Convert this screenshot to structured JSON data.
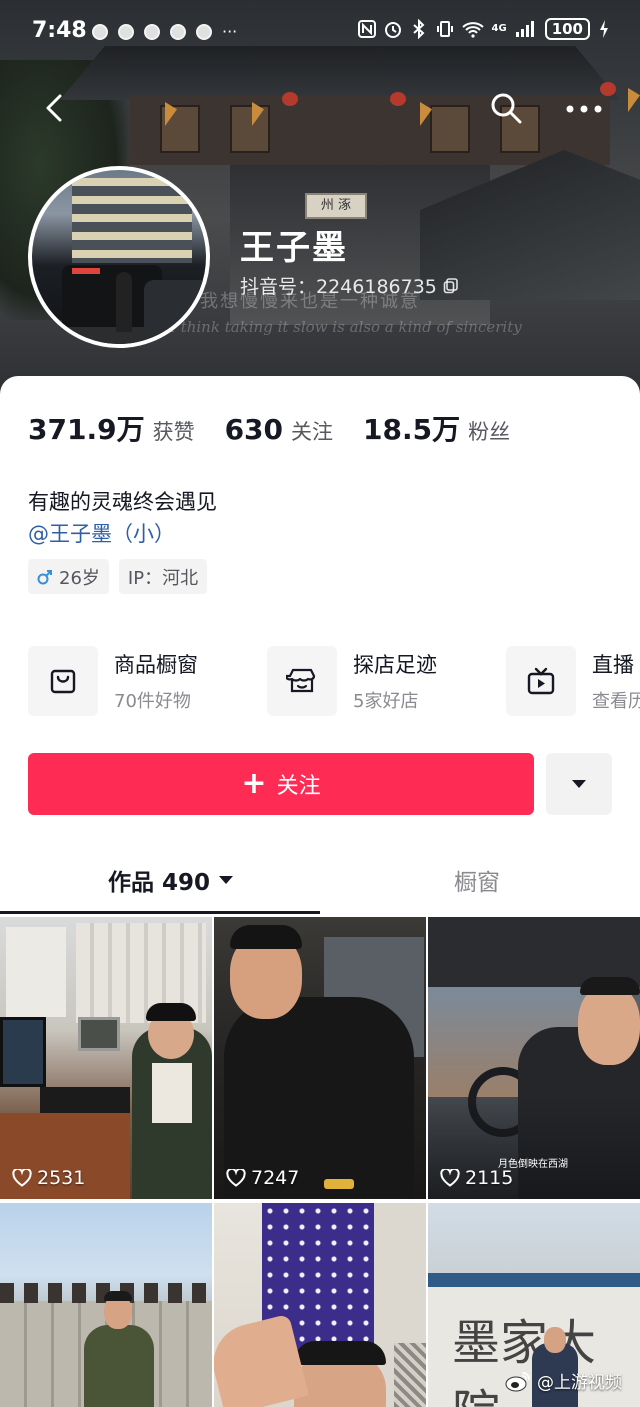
{
  "status_bar": {
    "time": "7:48",
    "more_dots": "···",
    "network": "4G",
    "battery": "100"
  },
  "cover": {
    "plaque_text": "州 涿",
    "signature_cn": "我想慢慢来也是一种诚意",
    "signature_en": "I think taking it slow is also a kind of sincerity"
  },
  "profile": {
    "nickname": "王子墨",
    "douyin_id": "抖音号：2246186735",
    "bio": "有趣的灵魂终会遇见",
    "mention": "@王子墨（小）",
    "tags": [
      {
        "icon": "male-icon",
        "label": "26岁"
      },
      {
        "label": "IP：河北"
      }
    ]
  },
  "stats": [
    {
      "value": "371.9万",
      "label": "获赞"
    },
    {
      "value": "630",
      "label": "关注"
    },
    {
      "value": "18.5万",
      "label": "粉丝"
    }
  ],
  "features": [
    {
      "icon": "shopping-bag-icon",
      "title": "商品橱窗",
      "subtitle": "70件好物"
    },
    {
      "icon": "store-icon",
      "title": "探店足迹",
      "subtitle": "5家好店"
    },
    {
      "icon": "tv-icon",
      "title": "直播",
      "subtitle": "查看历"
    }
  ],
  "actions": {
    "follow_label": "关注",
    "follow_plus": "+"
  },
  "tabs": {
    "works": "作品 490",
    "shop": "橱窗"
  },
  "videos": [
    {
      "likes": "2531"
    },
    {
      "likes": "7247"
    },
    {
      "likes": "2115",
      "caption": "月色倒映在西湖"
    },
    {
      "likes": ""
    },
    {
      "likes": ""
    },
    {
      "likes": "",
      "caption": "墨家大院"
    }
  ],
  "watermark": {
    "text": "@上游视频"
  },
  "colors": {
    "follow_button": "#fe2c55",
    "mention": "#2e5ea8",
    "primary_text": "#161823",
    "secondary_text": "#8a8b90"
  }
}
